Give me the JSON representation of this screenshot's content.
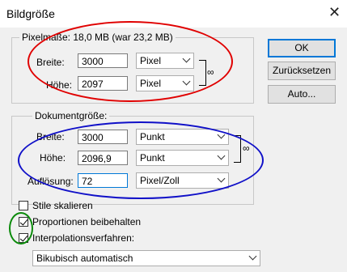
{
  "window": {
    "title": "Bildgröße",
    "close_glyph": "✕"
  },
  "pixel_group": {
    "legend": "Pixelmaße: 18,0 MB (war 23,2 MB)",
    "width_label": "Breite:",
    "width_value": "3000",
    "width_unit": "Pixel",
    "height_label": "Höhe:",
    "height_value": "2097",
    "height_unit": "Pixel",
    "link_icon": "chain-link-icon"
  },
  "document_group": {
    "legend": "Dokumentgröße:",
    "width_label": "Breite:",
    "width_value": "3000",
    "width_unit": "Punkt",
    "height_label": "Höhe:",
    "height_value": "2096,9",
    "height_unit": "Punkt",
    "resolution_label": "Auflösung:",
    "resolution_value": "72",
    "resolution_unit": "Pixel/Zoll",
    "link_icon": "chain-link-icon"
  },
  "options": {
    "scale_styles": {
      "label": "Stile skalieren",
      "checked": false
    },
    "constrain": {
      "label": "Proportionen beibehalten",
      "checked": true
    },
    "resample": {
      "label": "Interpolationsverfahren:",
      "checked": true
    },
    "method": "Bikubisch automatisch"
  },
  "buttons": {
    "ok": "OK",
    "reset": "Zurücksetzen",
    "auto": "Auto..."
  },
  "annotation_colors": {
    "red": "#e00000",
    "blue": "#1010c8",
    "green": "#0a8a0a"
  }
}
